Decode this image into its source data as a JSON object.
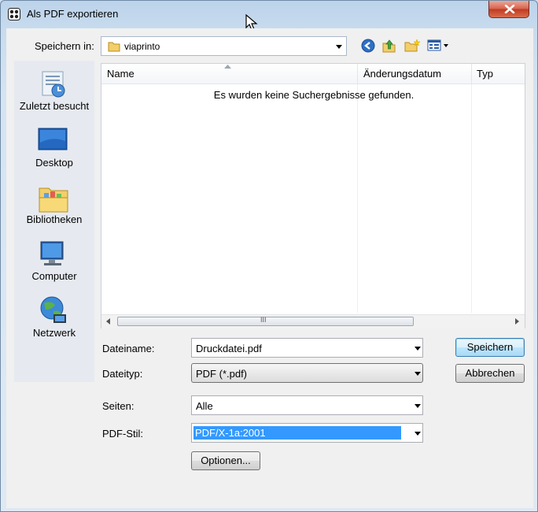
{
  "window": {
    "title": "Als PDF exportieren",
    "close_symbol": "x"
  },
  "toolbar": {
    "lookin_label": "Speichern in:",
    "current_folder": "viaprinto",
    "icons": [
      "back-icon",
      "up-folder-icon",
      "new-folder-icon",
      "view-menu-icon"
    ]
  },
  "places": [
    {
      "label": "Zuletzt besucht",
      "icon": "recent-places-icon"
    },
    {
      "label": "Desktop",
      "icon": "desktop-icon"
    },
    {
      "label": "Bibliotheken",
      "icon": "libraries-icon"
    },
    {
      "label": "Computer",
      "icon": "computer-icon"
    },
    {
      "label": "Netzwerk",
      "icon": "network-icon"
    }
  ],
  "filelist": {
    "columns": [
      "Name",
      "Änderungsdatum",
      "Typ"
    ],
    "empty_message": "Es wurden keine Suchergebnisse gefunden.",
    "scroll_grip": "III"
  },
  "form": {
    "filename_label": "Dateiname:",
    "filename_value": "Druckdatei.pdf",
    "filetype_label": "Dateityp:",
    "filetype_value": "PDF (*.pdf)",
    "pages_label": "Seiten:",
    "pages_value": "Alle",
    "pdfstyle_label": "PDF-Stil:",
    "pdfstyle_value": "PDF/X-1a:2001",
    "options_button": "Optionen..."
  },
  "buttons": {
    "save": "Speichern",
    "cancel": "Abbrechen"
  },
  "colors": {
    "selection": "#3399ff",
    "close_button": "#c0391f"
  }
}
